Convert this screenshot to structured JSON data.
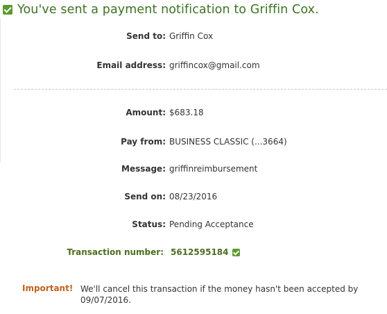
{
  "heading": {
    "text": "You've sent a payment notification to Griffin Cox."
  },
  "recipient": {
    "send_to_label": "Send to:",
    "send_to_value": "Griffin Cox",
    "email_label": "Email address:",
    "email_value": "griffincox@gmail.com"
  },
  "payment": {
    "amount_label": "Amount:",
    "amount_value": "$683.18",
    "pay_from_label": "Pay from:",
    "pay_from_value": "BUSINESS CLASSIC (...3664)",
    "message_label": "Message:",
    "message_value": "griffinreimbursement",
    "send_on_label": "Send on:",
    "send_on_value": "08/23/2016",
    "status_label": "Status:",
    "status_value": "Pending Acceptance",
    "transaction_label": "Transaction number:",
    "transaction_value": "5612595184"
  },
  "notice": {
    "label": "Important!",
    "text": "We'll cancel this transaction if the money hasn't been accepted by 09/07/2016."
  },
  "colors": {
    "heading_green": "#3d7324",
    "check_green": "#5b9a2e",
    "transaction_green": "#4c6e1f",
    "important_orange": "#c0621c"
  },
  "icons": {
    "heading_icon": "check-box-icon",
    "transaction_icon": "check-box-icon"
  }
}
